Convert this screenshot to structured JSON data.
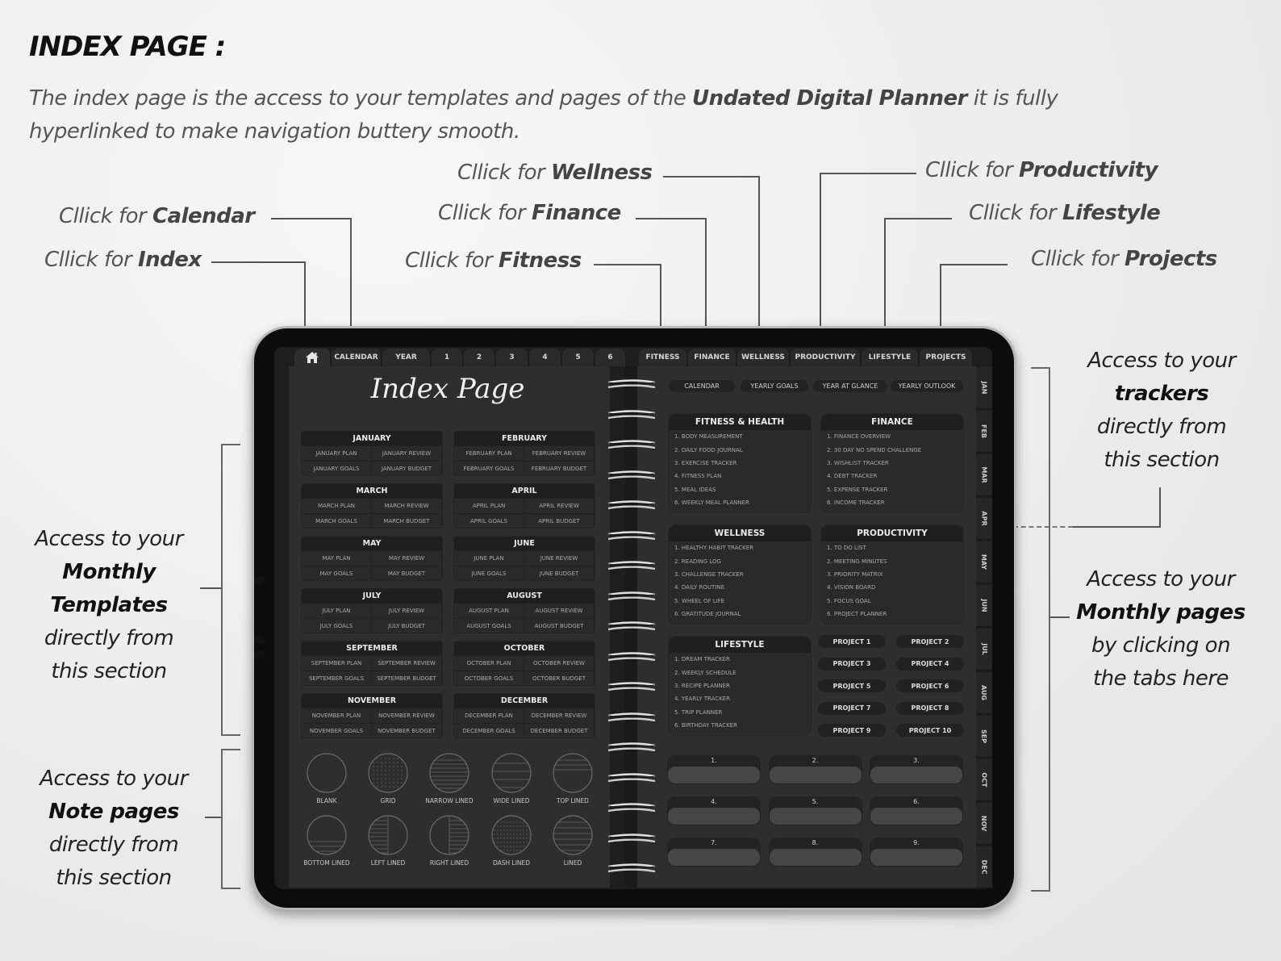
{
  "header": {
    "title": "INDEX PAGE :",
    "intro_prefix": "The index page is the access to your templates and pages of the ",
    "intro_bold": "Undated Digital Planner",
    "intro_suffix": " it is fully hyperlinked to make navigation buttery smooth."
  },
  "callouts": {
    "prefix": "Cllick for ",
    "index": "Index",
    "calendar": "Calendar",
    "fitness": "Fitness",
    "finance": "Finance",
    "wellness": "Wellness",
    "productivity": "Productivity",
    "lifestyle": "Lifestyle",
    "projects": "Projects"
  },
  "side_notes": {
    "monthly_templates": {
      "l1": "Access to your",
      "b1": "Monthly",
      "b2": "Templates",
      "l2": "directly from",
      "l3": "this section"
    },
    "note_pages": {
      "l1": "Access to your",
      "b1": "Note pages",
      "l2": "directly from",
      "l3": "this section"
    },
    "trackers": {
      "l1": "Access to your",
      "b1": "trackers",
      "l2": "directly from",
      "l3": "this section"
    },
    "monthly_pages": {
      "l1": "Access to your",
      "b1": "Monthly pages",
      "l2": "by clicking on",
      "l3": "the tabs here"
    }
  },
  "planner": {
    "home_icon": "home-icon",
    "left_tabs": [
      "CALENDAR",
      "YEAR",
      "1",
      "2",
      "3",
      "4",
      "5",
      "6"
    ],
    "right_tabs": [
      "FITNESS",
      "FINANCE",
      "WELLNESS",
      "PRODUCTIVITY",
      "LIFESTYLE",
      "PROJECTS"
    ],
    "month_tabs": [
      "JAN",
      "FEB",
      "MAR",
      "APR",
      "MAY",
      "JUN",
      "JUL",
      "AUG",
      "SEP",
      "OCT",
      "NOV",
      "DEC"
    ],
    "page_title": "Index Page",
    "months": [
      {
        "name": "JANUARY",
        "links": [
          "JANUARY PLAN",
          "JANUARY REVIEW",
          "JANUARY GOALS",
          "JANUARY BUDGET"
        ]
      },
      {
        "name": "FEBRUARY",
        "links": [
          "FEBRUARY PLAN",
          "FEBRUARY REVIEW",
          "FEBRUARY GOALS",
          "FEBRUARY BUDGET"
        ]
      },
      {
        "name": "MARCH",
        "links": [
          "MARCH PLAN",
          "MARCH REVIEW",
          "MARCH GOALS",
          "MARCH BUDGET"
        ]
      },
      {
        "name": "APRIL",
        "links": [
          "APRIL PLAN",
          "APRIL REVIEW",
          "APRIL GOALS",
          "APRIL BUDGET"
        ]
      },
      {
        "name": "MAY",
        "links": [
          "MAY PLAN",
          "MAY REVIEW",
          "MAY GOALS",
          "MAY BUDGET"
        ]
      },
      {
        "name": "JUNE",
        "links": [
          "JUNE PLAN",
          "JUNE REVIEW",
          "JUNE GOALS",
          "JUNE BUDGET"
        ]
      },
      {
        "name": "JULY",
        "links": [
          "JULY PLAN",
          "JULY REVIEW",
          "JULY GOALS",
          "JULY BUDGET"
        ]
      },
      {
        "name": "AUGUST",
        "links": [
          "AUGUST PLAN",
          "AUGUST REVIEW",
          "AUGUST GOALS",
          "AUGUST BUDGET"
        ]
      },
      {
        "name": "SEPTEMBER",
        "links": [
          "SEPTEMBER PLAN",
          "SEPTEMBER REVIEW",
          "SEPTEMBER GOALS",
          "SEPTEMBER BUDGET"
        ]
      },
      {
        "name": "OCTOBER",
        "links": [
          "OCTOBER PLAN",
          "OCTOBER REVIEW",
          "OCTOBER GOALS",
          "OCTOBER BUDGET"
        ]
      },
      {
        "name": "NOVEMBER",
        "links": [
          "NOVEMBER PLAN",
          "NOVEMBER REVIEW",
          "NOVEMBER GOALS",
          "NOVEMBER BUDGET"
        ]
      },
      {
        "name": "DECEMBER",
        "links": [
          "DECEMBER PLAN",
          "DECEMBER REVIEW",
          "DECEMBER GOALS",
          "DECEMBER BUDGET"
        ]
      }
    ],
    "notes": [
      {
        "label": "BLANK",
        "pattern": "blank"
      },
      {
        "label": "GRID",
        "pattern": "grid"
      },
      {
        "label": "NARROW LINED",
        "pattern": "narrow"
      },
      {
        "label": "WIDE LINED",
        "pattern": "wide"
      },
      {
        "label": "TOP LINED",
        "pattern": "top"
      },
      {
        "label": "BOTTOM LINED",
        "pattern": "bottom"
      },
      {
        "label": "LEFT LINED",
        "pattern": "left"
      },
      {
        "label": "RIGHT LINED",
        "pattern": "right"
      },
      {
        "label": "DASH LINED",
        "pattern": "dash"
      },
      {
        "label": "LINED",
        "pattern": "lined"
      }
    ],
    "quick_links": [
      "CALENDAR",
      "YEARLY GOALS",
      "YEAR AT GLANCE",
      "YEARLY OUTLOOK"
    ],
    "trackers": [
      {
        "title": "FITNESS & HEALTH",
        "items": [
          "1. BODY MEASUREMENT",
          "2. DAILY FOOD JOURNAL",
          "3. EXERCISE TRACKER",
          "4. FITNESS PLAN",
          "5. MEAL IDEAS",
          "6. WEEKLY MEAL PLANNER"
        ]
      },
      {
        "title": "FINANCE",
        "items": [
          "1. FINANCE OVERVIEW",
          "2. 30 DAY NO SPEND CHALLENGE",
          "3. WISHLIST TRACKER",
          "4. DEBT TRACKER",
          "5. EXPENSE TRACKER",
          "6. INCOME TRACKER"
        ]
      },
      {
        "title": "WELLNESS",
        "items": [
          "1. HEALTHY HABIT TRACKER",
          "2. READING LOG",
          "3. CHALLENGE TRACKER",
          "4. DAILY ROUTINE",
          "5. WHEEL OF LIFE",
          "6. GRATITUDE JOURNAL"
        ]
      },
      {
        "title": "PRODUCTIVITY",
        "items": [
          "1. TO DO LIST",
          "2. MEETING MINUTES",
          "3. PRIORITY MATRIX",
          "4. VISION BOARD",
          "5. FOCUS GOAL",
          "6. PROJECT PLANNER"
        ]
      },
      {
        "title": "LIFESTYLE",
        "items": [
          "1. DREAM TRACKER",
          "2. WEEKLY SCHEDULE",
          "3. RECIPE PLANNER",
          "4. YEARLY TRACKER",
          "5. TRIP PLANNER",
          "6. BIRTHDAY TRACKER"
        ]
      }
    ],
    "projects": [
      "PROJECT 1",
      "PROJECT 2",
      "PROJECT 3",
      "PROJECT 4",
      "PROJECT 5",
      "PROJECT 6",
      "PROJECT 7",
      "PROJECT 8",
      "PROJECT 9",
      "PROJECT 10"
    ],
    "slots": [
      "1.",
      "2.",
      "3.",
      "4.",
      "5.",
      "6.",
      "7.",
      "8.",
      "9."
    ]
  }
}
